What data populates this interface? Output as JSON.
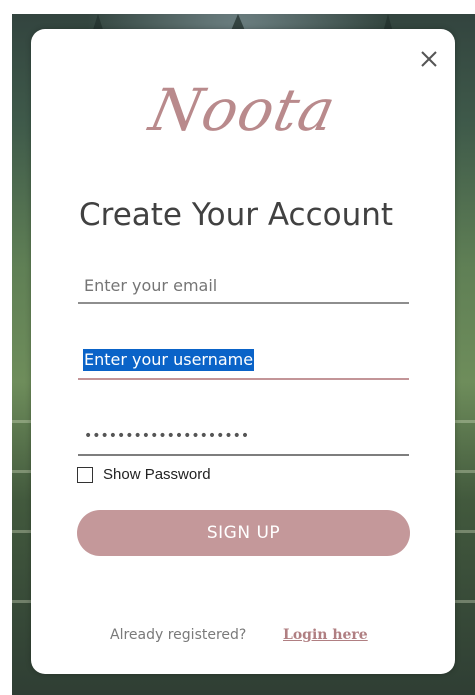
{
  "app": {
    "logo_text": "Noota"
  },
  "form": {
    "title": "Create Your Account",
    "email": {
      "placeholder": "Enter your email",
      "value": ""
    },
    "username": {
      "value": "Enter your username",
      "selected": true
    },
    "password": {
      "masked_value": "••••••••••••••••••••"
    },
    "show_password_label": "Show Password",
    "show_password_checked": false,
    "signup_label": "SIGN UP"
  },
  "footer": {
    "prompt": "Already registered?",
    "login_link": "Login here"
  },
  "icons": {
    "close": "close-icon"
  },
  "colors": {
    "accent": "#c4989a",
    "logo": "#b98a8c",
    "selection": "#0a63c8"
  }
}
